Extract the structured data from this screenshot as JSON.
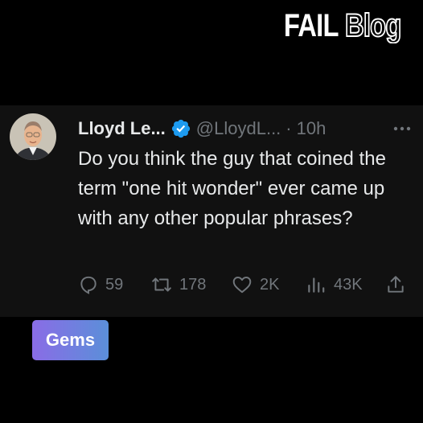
{
  "watermark": {
    "fail": "FAIL",
    "blog": "Blog"
  },
  "tweet": {
    "author_name": "Lloyd Le...",
    "handle": "@LloydL...",
    "separator": "·",
    "time": "10h",
    "text": "Do you think the guy that coined the term \"one hit wonder\" ever came up with any other popular phrases?",
    "stats": {
      "replies": "59",
      "reposts": "178",
      "likes": "2K",
      "views": "43K"
    }
  },
  "badge": {
    "label": "Gems"
  },
  "colors": {
    "background": "#000000",
    "card": "#111111",
    "verified": "#1d9bf0",
    "muted": "#71767b"
  }
}
